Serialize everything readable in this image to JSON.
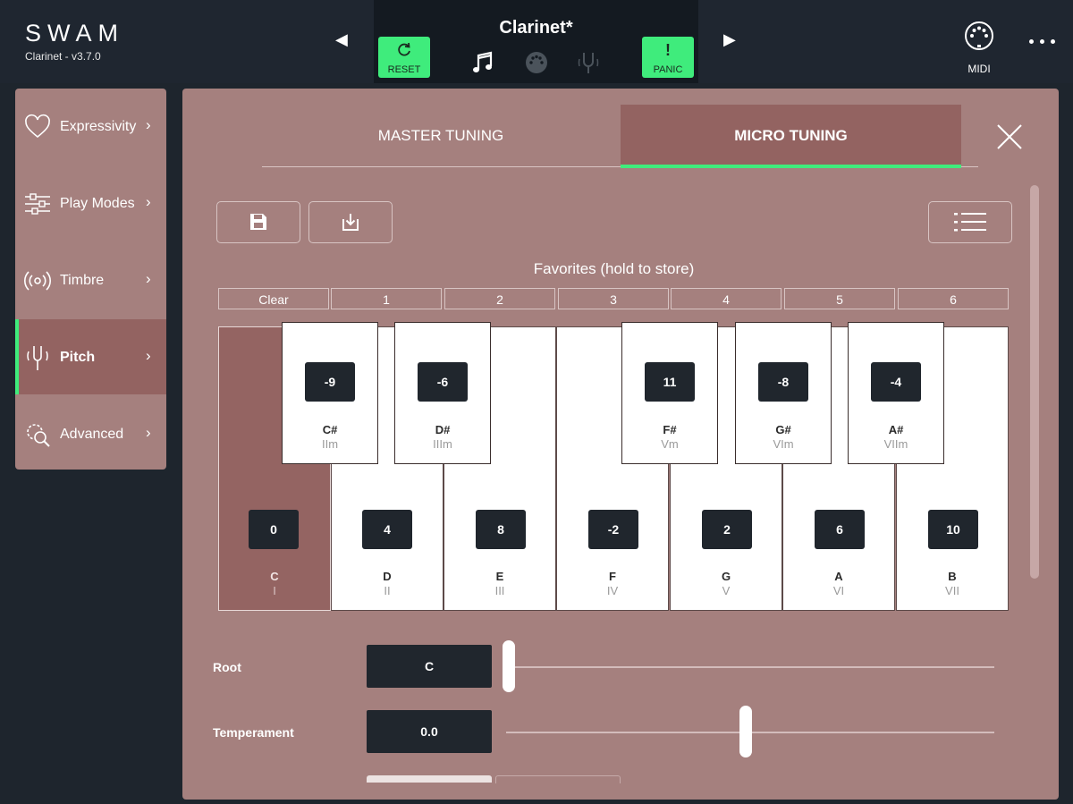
{
  "header": {
    "brand": "SWAM",
    "version": "Clarinet - v3.7.0",
    "prev_arrow": "◀",
    "next_arrow": "▶",
    "preset_name": "Clarinet*",
    "reset_label": "RESET",
    "panic_label": "PANIC",
    "panic_glyph": "!",
    "midi_label": "MIDI",
    "accent_color": "#3fec7c"
  },
  "sidebar": {
    "items": [
      {
        "label": "Expressivity",
        "icon": "heart-icon",
        "chevron": "›"
      },
      {
        "label": "Play Modes",
        "icon": "sliders-icon",
        "chevron": "›"
      },
      {
        "label": "Timbre",
        "icon": "radio-waves-icon",
        "chevron": "›"
      },
      {
        "label": "Pitch",
        "icon": "tuning-fork-icon",
        "chevron": "›",
        "active": true
      },
      {
        "label": "Advanced",
        "icon": "gear-magnifier-icon",
        "chevron": "›"
      }
    ]
  },
  "tuning": {
    "tabs": [
      "MASTER TUNING",
      "MICRO TUNING"
    ],
    "active_tab": "MICRO TUNING",
    "favorites_title": "Favorites (hold to store)",
    "favorites": [
      "Clear",
      "1",
      "2",
      "3",
      "4",
      "5",
      "6"
    ],
    "white_keys": [
      {
        "name": "C",
        "degree": "I",
        "value": "0",
        "selected": true
      },
      {
        "name": "D",
        "degree": "II",
        "value": "4"
      },
      {
        "name": "E",
        "degree": "III",
        "value": "8"
      },
      {
        "name": "F",
        "degree": "IV",
        "value": "-2"
      },
      {
        "name": "G",
        "degree": "V",
        "value": "2"
      },
      {
        "name": "A",
        "degree": "VI",
        "value": "6"
      },
      {
        "name": "B",
        "degree": "VII",
        "value": "10"
      }
    ],
    "black_keys": [
      {
        "name": "C#",
        "degree": "IIm",
        "value": "-9"
      },
      {
        "name": "D#",
        "degree": "IIIm",
        "value": "-6"
      },
      {
        "name": "F#",
        "degree": "Vm",
        "value": "11"
      },
      {
        "name": "G#",
        "degree": "VIm",
        "value": "-8"
      },
      {
        "name": "A#",
        "degree": "VIIm",
        "value": "-4"
      }
    ],
    "root": {
      "label": "Root",
      "value": "C",
      "slider_fraction": 0.0
    },
    "temperament": {
      "label": "Temperament",
      "value": "0.0",
      "slider_fraction": 0.5
    }
  }
}
